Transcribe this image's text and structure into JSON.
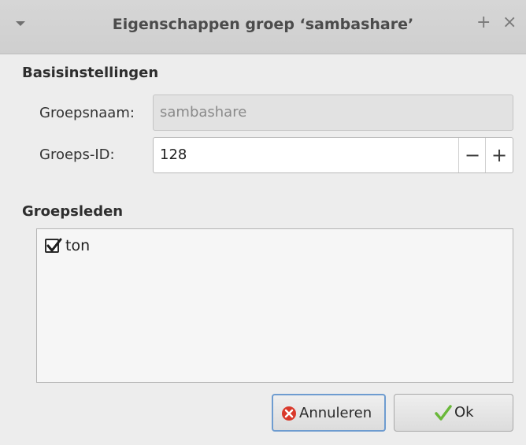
{
  "window": {
    "title": "Eigenschappen groep ‘sambashare’",
    "maximize_glyph": "+",
    "close_glyph": "×"
  },
  "basic": {
    "section_title": "Basisinstellingen",
    "name_label": "Groepsnaam:",
    "name_value": "sambashare",
    "id_label": "Groeps-ID:",
    "id_value": "128",
    "decrement_glyph": "−",
    "increment_glyph": "+"
  },
  "members": {
    "section_title": "Groepsleden",
    "items": [
      {
        "label": "ton",
        "checked": true
      }
    ]
  },
  "buttons": {
    "cancel_label": "Annuleren",
    "ok_label": "Ok"
  },
  "colors": {
    "cancel_icon": "#d9392b",
    "ok_icon": "#6ab83a",
    "focus_border": "#6e9cd0"
  },
  "icons": {
    "menu": "chevron-down-icon",
    "cancel": "cancel-circle-icon",
    "ok": "checkmark-icon"
  }
}
